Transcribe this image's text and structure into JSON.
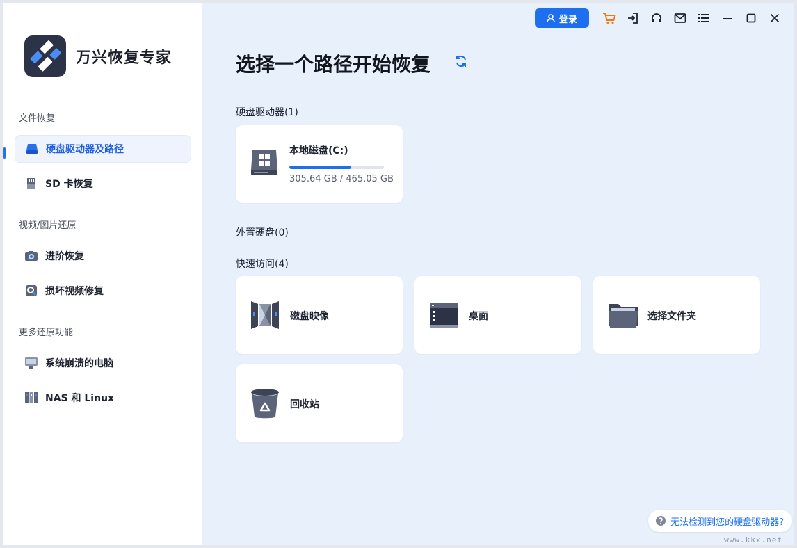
{
  "app": {
    "title": "万兴恢复专家"
  },
  "sidebar": {
    "sections": [
      {
        "label": "文件恢复"
      },
      {
        "label": "视频/图片还原"
      },
      {
        "label": "更多还原功能"
      }
    ],
    "items": [
      {
        "label": "硬盘驱动器及路径",
        "icon": "hard-drive-icon",
        "active": true
      },
      {
        "label": "SD 卡恢复",
        "icon": "sd-card-icon"
      },
      {
        "label": "进阶恢复",
        "icon": "camera-icon"
      },
      {
        "label": "损坏视频修复",
        "icon": "video-repair-icon"
      },
      {
        "label": "系统崩溃的电脑",
        "icon": "monitor-icon"
      },
      {
        "label": "NAS 和 Linux",
        "icon": "nas-icon"
      }
    ]
  },
  "topbar": {
    "login_label": "登录",
    "icons": [
      "cart-icon",
      "sign-in-icon",
      "headset-icon",
      "mail-icon",
      "menu-icon",
      "minimize-icon",
      "maximize-icon",
      "close-icon"
    ],
    "accent": "#1e6ff0",
    "cart_color": "#f07a12"
  },
  "main": {
    "title": "选择一个路径开始恢复",
    "groups": {
      "hard_drives": "硬盘驱动器(1)",
      "external": "外置硬盘(0)",
      "quick_access": "快速访问(4)"
    },
    "drive": {
      "name": "本地磁盘(C:)",
      "used": "305.64 GB",
      "separator": " / ",
      "total": "465.05 GB",
      "used_fraction": 0.657
    },
    "quick": [
      {
        "label": "磁盘映像",
        "icon": "disk-image-icon"
      },
      {
        "label": "桌面",
        "icon": "desktop-icon"
      },
      {
        "label": "选择文件夹",
        "icon": "folder-icon"
      },
      {
        "label": "回收站",
        "icon": "recycle-bin-icon"
      }
    ],
    "help": "无法检测到您的硬盘驱动器?",
    "watermark": "www.kkx.net"
  }
}
